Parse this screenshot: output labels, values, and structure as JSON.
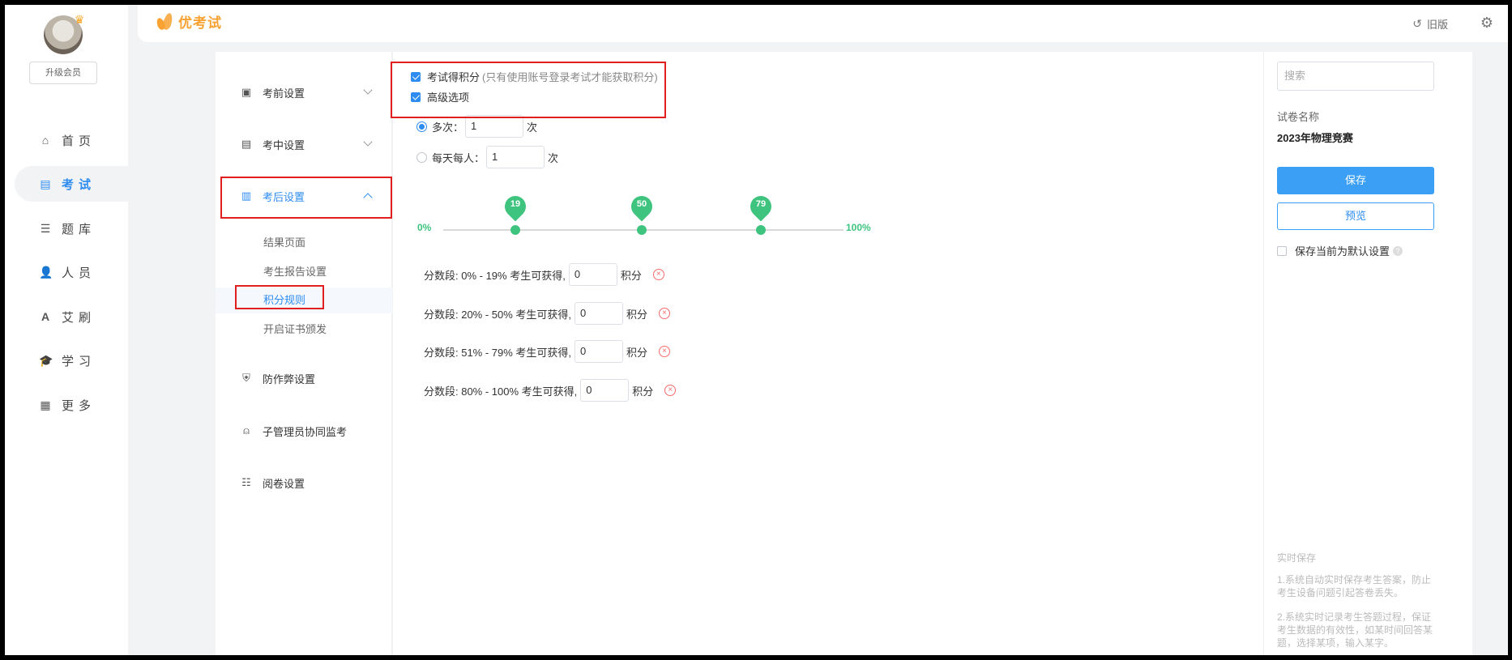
{
  "left_nav": {
    "upgrade_label": "升级会员",
    "items": [
      {
        "label": "首页",
        "icon": "home-icon"
      },
      {
        "label": "考试",
        "icon": "exam-icon"
      },
      {
        "label": "题库",
        "icon": "question-bank-icon"
      },
      {
        "label": "人员",
        "icon": "person-icon"
      },
      {
        "label": "艾刷",
        "icon": "font-a-icon"
      },
      {
        "label": "学习",
        "icon": "graduation-cap-icon"
      },
      {
        "label": "更多",
        "icon": "grid-icon"
      }
    ],
    "active_index": 1
  },
  "topbar": {
    "logo_text": "优考试",
    "old_version_label": "旧版"
  },
  "settings_menu": {
    "items": [
      {
        "label": "考前设置"
      },
      {
        "label": "考中设置"
      },
      {
        "label": "考后设置"
      },
      {
        "label": "防作弊设置"
      },
      {
        "label": "子管理员协同监考"
      },
      {
        "label": "阅卷设置"
      }
    ],
    "sub_items": [
      {
        "label": "结果页面"
      },
      {
        "label": "考生报告设置"
      },
      {
        "label": "积分规则"
      },
      {
        "label": "开启证书颁发"
      }
    ],
    "active_sub_index": 2
  },
  "main": {
    "points_checkbox_label": "考试得积分",
    "points_checkbox_hint": "(只有使用账号登录考试才能获取积分)",
    "advanced_checkbox_label": "高级选项",
    "multi_label": "多次：",
    "multi_value": "1",
    "multi_unit": "次",
    "daily_label": "每天每人：",
    "daily_value": "1",
    "daily_unit": "次",
    "slider": {
      "min_label": "0%",
      "max_label": "100%",
      "thumbs": [
        "19",
        "50",
        "79"
      ]
    },
    "segments": [
      {
        "text": "分数段: 0% - 19% 考生可获得,",
        "value": "0",
        "unit": "积分"
      },
      {
        "text": "分数段: 20% - 50% 考生可获得,",
        "value": "0",
        "unit": "积分"
      },
      {
        "text": "分数段: 51% - 79% 考生可获得,",
        "value": "0",
        "unit": "积分"
      },
      {
        "text": "分数段: 80% - 100% 考生可获得,",
        "value": "0",
        "unit": "积分"
      }
    ]
  },
  "right_panel": {
    "search_placeholder": "搜索",
    "paper_name_label": "试卷名称",
    "paper_name": "2023年物理竞赛",
    "save_label": "保存",
    "preview_label": "预览",
    "default_label": "保存当前为默认设置",
    "tips_title": "实时保存",
    "tip1": "1.系统自动实时保存考生答案，防止考生设备问题引起答卷丢失。",
    "tip2": "2.系统实时记录考生答题过程，保证考生数据的有效性，如某时间回答某题，选择某项，输入某字。"
  },
  "colors": {
    "accent": "#2e8cf0",
    "slider_green": "#3fc47f",
    "highlight_red": "#e02020",
    "logo_orange": "#f7a233"
  }
}
